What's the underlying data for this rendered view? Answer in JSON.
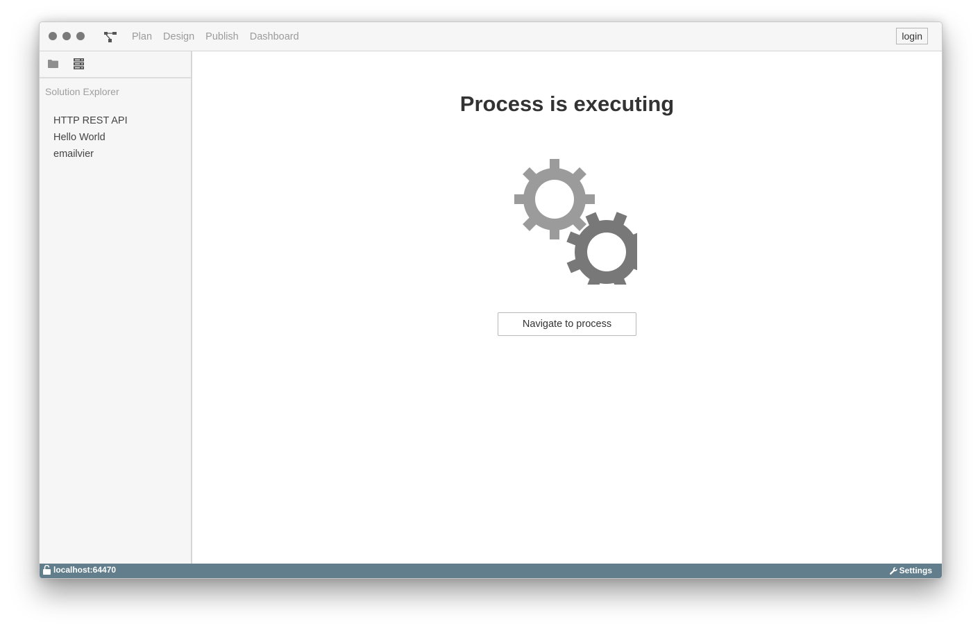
{
  "nav": {
    "items": [
      {
        "label": "Plan"
      },
      {
        "label": "Design"
      },
      {
        "label": "Publish"
      },
      {
        "label": "Dashboard"
      }
    ],
    "login_label": "login"
  },
  "sidebar": {
    "title": "Solution Explorer",
    "items": [
      {
        "label": "HTTP REST API"
      },
      {
        "label": "Hello World"
      },
      {
        "label": "emailvier"
      }
    ]
  },
  "main": {
    "title": "Process is executing",
    "button_label": "Navigate to process"
  },
  "status": {
    "host": "localhost:64470",
    "settings_label": "Settings"
  },
  "icons": {
    "app": "workflow-icon",
    "folder": "folder-icon",
    "server": "server-icon",
    "gears": "gears-icon",
    "lock": "lock-open-icon",
    "wrench": "wrench-icon"
  },
  "colors": {
    "statusbar": "#627e8c",
    "gear_light": "#9b9b9b",
    "gear_dark": "#787878"
  }
}
